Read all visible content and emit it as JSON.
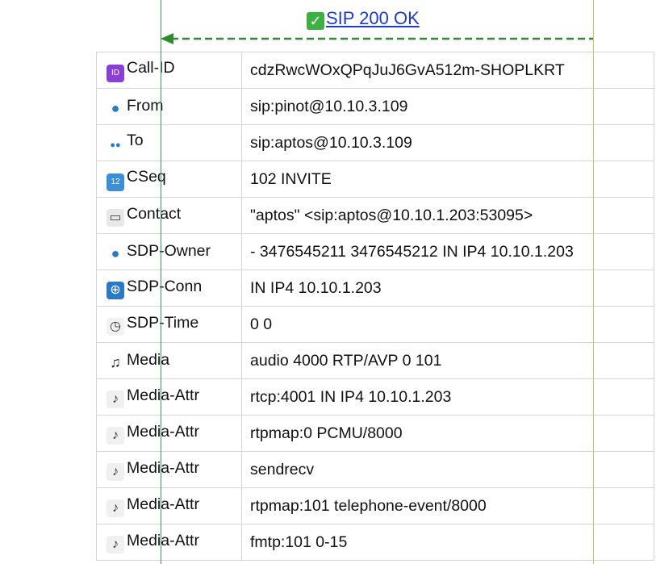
{
  "message": {
    "label": "SIP 200 OK",
    "icon": "check-mark-icon"
  },
  "rows": [
    {
      "key": "Call-ID",
      "icon": "id-badge-icon",
      "value": "cdzRwcWOxQPqJuJ6GvA512m-SHOPLKRT"
    },
    {
      "key": "From",
      "icon": "person-icon",
      "value": "sip:pinot@10.10.3.109"
    },
    {
      "key": "To",
      "icon": "people-icon",
      "value": "sip:aptos@10.10.3.109"
    },
    {
      "key": "CSeq",
      "icon": "numbers-icon",
      "value": "102 INVITE"
    },
    {
      "key": "Contact",
      "icon": "contact-card-icon",
      "value": "\"aptos\" <sip:aptos@10.10.1.203:53095>"
    },
    {
      "key": "SDP-Owner",
      "icon": "person-icon",
      "value": "- 3476545211 3476545212 IN IP4 10.10.1.203"
    },
    {
      "key": "SDP-Conn",
      "icon": "globe-icon",
      "value": "IN IP4 10.10.1.203"
    },
    {
      "key": "SDP-Time",
      "icon": "clock-icon",
      "value": "0 0"
    },
    {
      "key": "Media",
      "icon": "music-note-icon",
      "value": "audio 4000 RTP/AVP 0 101"
    },
    {
      "key": "Media-Attr",
      "icon": "sheet-music-icon",
      "value": "rtcp:4001 IN IP4 10.10.1.203"
    },
    {
      "key": "Media-Attr",
      "icon": "sheet-music-icon",
      "value": "rtpmap:0 PCMU/8000"
    },
    {
      "key": "Media-Attr",
      "icon": "sheet-music-icon",
      "value": "sendrecv"
    },
    {
      "key": "Media-Attr",
      "icon": "sheet-music-icon",
      "value": "rtpmap:101 telephone-event/8000"
    },
    {
      "key": "Media-Attr",
      "icon": "sheet-music-icon",
      "value": "fmtp:101 0-15"
    }
  ],
  "colors": {
    "left_lifeline": "#2aa84a",
    "right_lifeline": "#f0b35a",
    "arrow": "#2e8b2e",
    "link": "#1a3cc9"
  }
}
